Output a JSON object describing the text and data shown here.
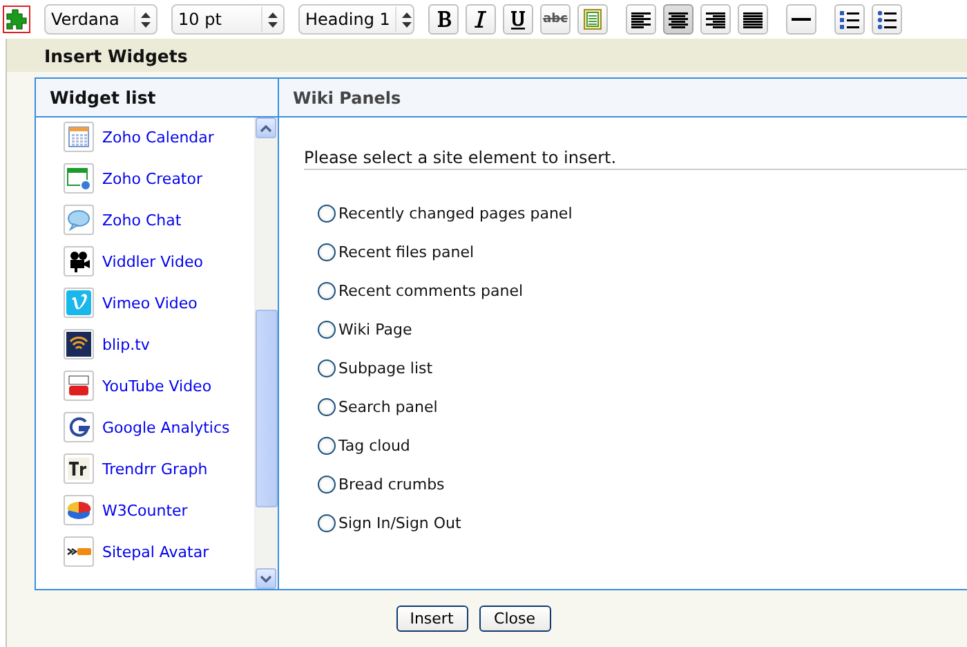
{
  "toolbar": {
    "selects": [
      {
        "value": "Verdana"
      },
      {
        "value": "10 pt"
      },
      {
        "value": "Heading 1"
      }
    ],
    "buttons": [
      {
        "kind": "bold",
        "pressed": false
      },
      {
        "kind": "italic",
        "pressed": false
      },
      {
        "kind": "underline",
        "pressed": false
      },
      {
        "kind": "strike",
        "pressed": false,
        "label": "abc"
      },
      {
        "kind": "paste",
        "pressed": false
      },
      {
        "kind": "align-left",
        "pressed": false
      },
      {
        "kind": "align-center",
        "pressed": true
      },
      {
        "kind": "align-right",
        "pressed": false
      },
      {
        "kind": "justify",
        "pressed": false
      },
      {
        "kind": "rule",
        "pressed": false
      },
      {
        "kind": "ordered-list",
        "pressed": false
      },
      {
        "kind": "bullet-list",
        "pressed": false
      }
    ]
  },
  "dialog": {
    "title": "Insert Widgets",
    "widget_list": {
      "heading": "Widget list",
      "items": [
        {
          "label": "Zoho Calendar",
          "selected": false
        },
        {
          "label": "Zoho Creator",
          "selected": false
        },
        {
          "label": "Zoho Chat",
          "selected": false
        },
        {
          "label": "Viddler Video",
          "selected": false
        },
        {
          "label": "Vimeo Video",
          "selected": false
        },
        {
          "label": "blip.tv",
          "selected": false
        },
        {
          "label": "YouTube Video",
          "selected": false
        },
        {
          "label": "Google Analytics",
          "selected": false
        },
        {
          "label": "Trendrr Graph",
          "selected": false
        },
        {
          "label": "W3Counter",
          "selected": false
        },
        {
          "label": "Sitepal Avatar",
          "selected": false
        }
      ]
    },
    "panel": {
      "heading": "Wiki Panels",
      "prompt": "Please select a site element to insert.",
      "options": [
        {
          "label": "Recently changed pages panel",
          "selected": false
        },
        {
          "label": "Recent files panel",
          "selected": false
        },
        {
          "label": "Recent comments panel",
          "selected": false
        },
        {
          "label": "Wiki Page",
          "selected": false
        },
        {
          "label": "Subpage list",
          "selected": false
        },
        {
          "label": "Search panel",
          "selected": false
        },
        {
          "label": "Tag cloud",
          "selected": false
        },
        {
          "label": "Bread crumbs",
          "selected": false
        },
        {
          "label": "Sign In/Sign Out",
          "selected": false
        }
      ]
    },
    "buttons": [
      {
        "label": "Insert"
      },
      {
        "label": "Close"
      }
    ]
  }
}
